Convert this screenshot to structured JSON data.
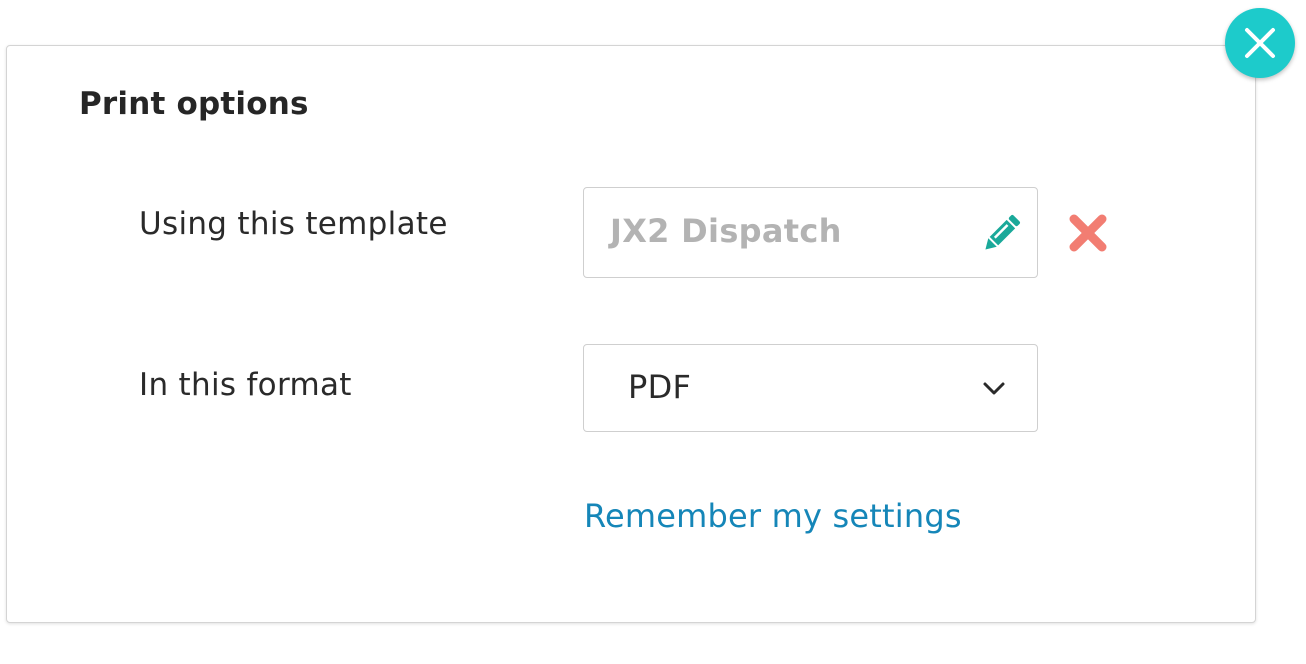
{
  "dialog": {
    "title": "Print options",
    "close_icon": "close-icon",
    "accent_color": "#1dcbcb"
  },
  "template_row": {
    "label": "Using this template",
    "value": "JX2 Dispatch",
    "edit_icon": "pencil-icon",
    "edit_icon_color": "#1aa99a",
    "remove_icon": "remove-x-icon",
    "remove_icon_color": "#f27d72"
  },
  "format_row": {
    "label": "In this format",
    "selected": "PDF",
    "dropdown_icon": "chevron-down-icon"
  },
  "remember_link": {
    "label": "Remember my settings",
    "color": "#1586b8"
  }
}
